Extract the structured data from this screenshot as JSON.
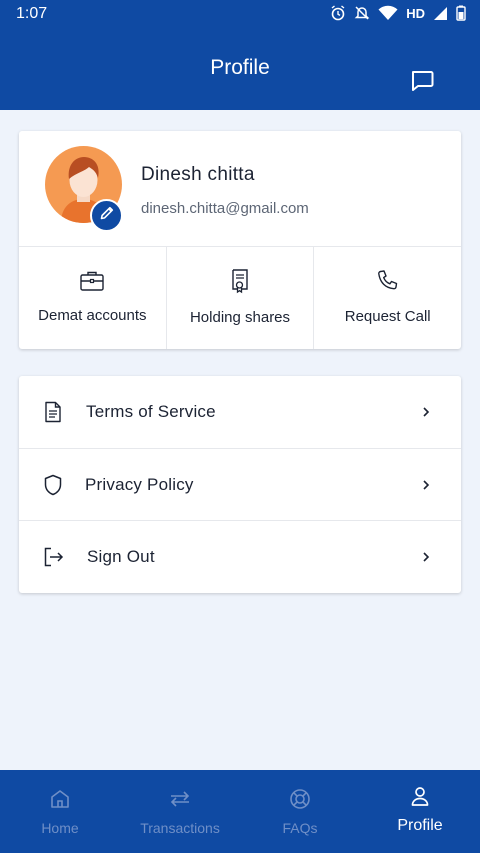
{
  "status_bar": {
    "time": "1:07",
    "network_label": "HD"
  },
  "header": {
    "title": "Profile",
    "action_icon": "chat-icon"
  },
  "profile": {
    "name": "Dinesh chitta",
    "email": "dinesh.chitta@gmail.com",
    "avatar_color": "#f59a52",
    "edit_icon": "pencil-icon"
  },
  "quick_actions": [
    {
      "label": "Demat accounts",
      "icon": "briefcase-icon"
    },
    {
      "label": "Holding shares",
      "icon": "certificate-icon"
    },
    {
      "label": "Request Call",
      "icon": "phone-icon"
    }
  ],
  "menu": [
    {
      "label": "Terms of Service",
      "icon": "document-icon"
    },
    {
      "label": "Privacy Policy",
      "icon": "shield-icon"
    },
    {
      "label": "Sign Out",
      "icon": "logout-icon"
    }
  ],
  "bottom_nav": {
    "active": "Profile",
    "items": [
      {
        "label": "Home",
        "icon": "home-icon"
      },
      {
        "label": "Transactions",
        "icon": "transfer-icon"
      },
      {
        "label": "FAQs",
        "icon": "lifebuoy-icon"
      },
      {
        "label": "Profile",
        "icon": "user-icon"
      }
    ]
  },
  "colors": {
    "primary": "#0f4aa3",
    "background": "#eef3fb",
    "inactive_nav": "#6f8fc7"
  }
}
